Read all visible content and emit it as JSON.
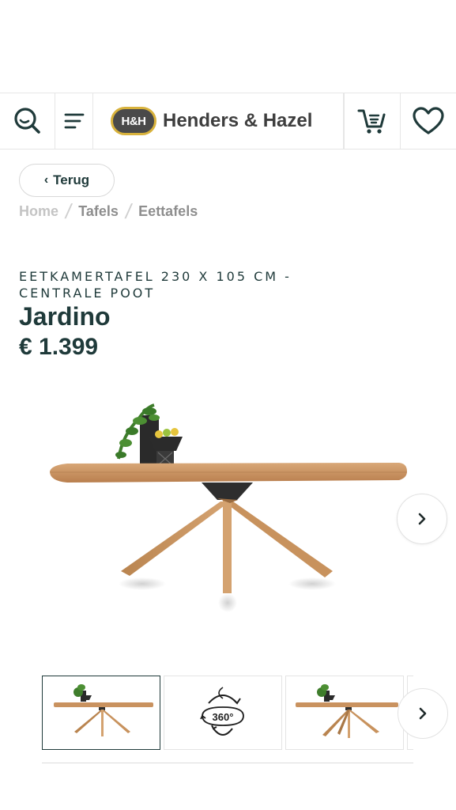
{
  "header": {
    "logo_badge": "H&H",
    "brand_name": "Henders & Hazel"
  },
  "nav": {
    "back_label": "Terug",
    "breadcrumb": [
      "Home",
      "Tafels",
      "Eettafels"
    ]
  },
  "product": {
    "subtitle": "EETKAMERTAFEL 230 X 105 CM - CENTRALE POOT",
    "name": "Jardino",
    "price": "€ 1.399"
  },
  "gallery": {
    "thumb_360_label": "360°"
  },
  "colors": {
    "text_dark": "#1f3a3a",
    "logo_gold": "#d8b23c",
    "logo_gray": "#4a4a4a",
    "wood": "#c9925f"
  },
  "icons": [
    "search-icon",
    "menu-icon",
    "cart-icon",
    "heart-icon",
    "chevron-left-icon",
    "chevron-right-icon",
    "rotate-360-icon"
  ]
}
